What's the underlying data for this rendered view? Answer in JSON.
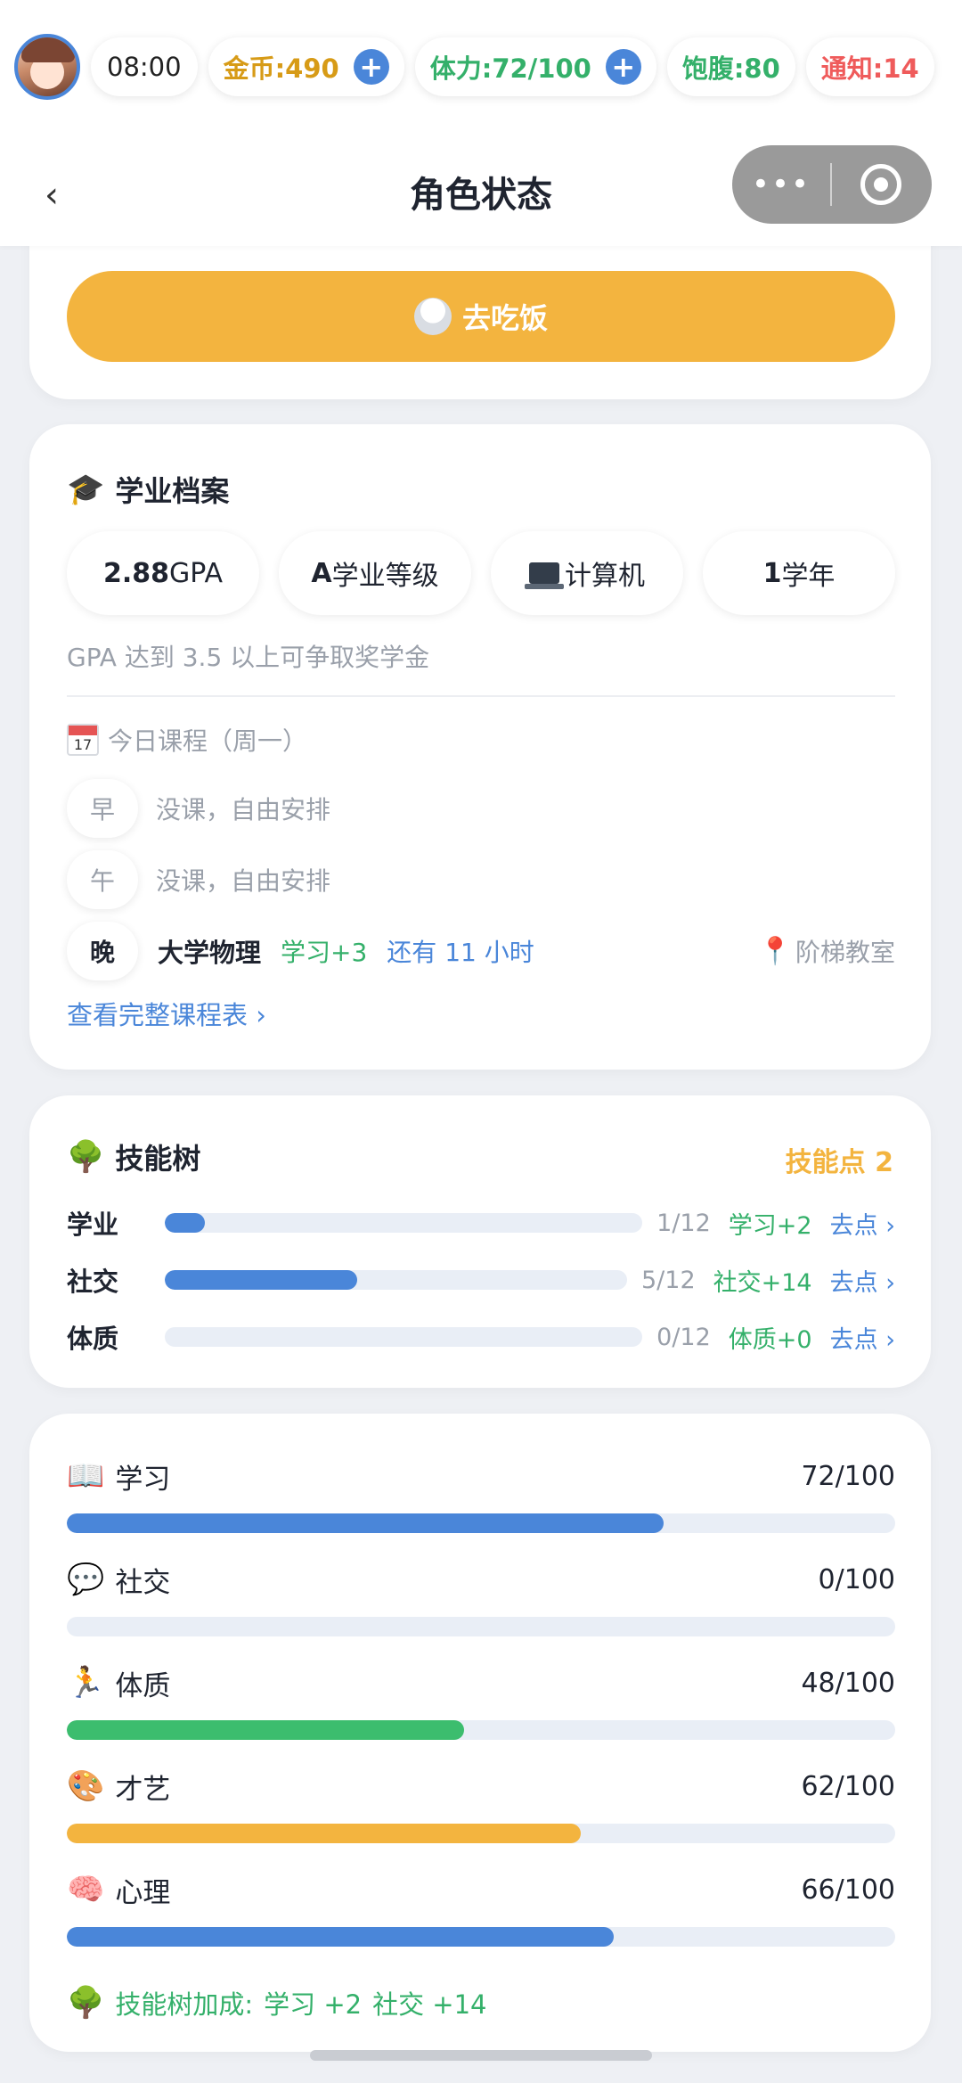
{
  "status_bar": {
    "time": "08:00",
    "gold": "金币:490",
    "stamina": "体力:72/100",
    "satiety": "饱腹:80",
    "notice": "通知:14",
    "plus": "+"
  },
  "nav": {
    "back": "‹",
    "title": "角色状态",
    "more": "•••"
  },
  "eat": {
    "label": "去吃饭",
    "icon": "rice-bowl-icon"
  },
  "academic": {
    "title": "学业档案",
    "icon": "graduation-cap-icon",
    "gpa_value": "2.88",
    "gpa_unit": "GPA",
    "grade_value": "A",
    "grade_unit": "学业等级",
    "major": "计算机",
    "year_value": "1",
    "year_unit": "学年",
    "hint": "GPA 达到 3.5 以上可争取奖学金",
    "today_label": "今日课程（周一）",
    "calendar_day": "17",
    "slots": [
      {
        "badge": "早",
        "text": "没课，自由安排"
      },
      {
        "badge": "午",
        "text": "没课，自由安排"
      },
      {
        "badge": "晚",
        "course": "大学物理",
        "gain": "学习+3",
        "time": "还有 11 小时",
        "location": "阶梯教室"
      }
    ],
    "schedule_link": "查看完整课程表 ›"
  },
  "skill_tree": {
    "title": "技能树",
    "icon": "tree-icon",
    "points": "技能点 2",
    "rows": [
      {
        "name": "学业",
        "count": "1/12",
        "bonus": "学习+2",
        "go": "去点 ›",
        "progress": 0.083
      },
      {
        "name": "社交",
        "count": "5/12",
        "bonus": "社交+14",
        "go": "去点 ›",
        "progress": 0.417
      },
      {
        "name": "体质",
        "count": "0/12",
        "bonus": "体质+0",
        "go": "去点 ›",
        "progress": 0
      }
    ]
  },
  "attributes": {
    "items": [
      {
        "icon": "📖",
        "icon_name": "book-icon",
        "name": "学习",
        "value": "72/100",
        "progress": 0.72,
        "color": "#4a86d9"
      },
      {
        "icon": "💬",
        "icon_name": "speech-bubble-icon",
        "name": "社交",
        "value": "0/100",
        "progress": 0,
        "color": "#4a86d9"
      },
      {
        "icon": "🏃",
        "icon_name": "runner-icon",
        "name": "体质",
        "value": "48/100",
        "progress": 0.48,
        "color": "#3cbd6e"
      },
      {
        "icon": "🎨",
        "icon_name": "palette-icon",
        "name": "才艺",
        "value": "62/100",
        "progress": 0.62,
        "color": "#f3b43f"
      },
      {
        "icon": "🧠",
        "icon_name": "brain-icon",
        "name": "心理",
        "value": "66/100",
        "progress": 0.66,
        "color": "#4a86d9"
      }
    ],
    "bonus_label": "技能树加成:",
    "bonus_study": "学习 +2",
    "bonus_social": "社交 +14"
  },
  "colors": {
    "accent_blue": "#4a86d9",
    "accent_orange": "#f3b43f",
    "accent_green": "#34b06a",
    "alert_red": "#ef5b5b"
  }
}
